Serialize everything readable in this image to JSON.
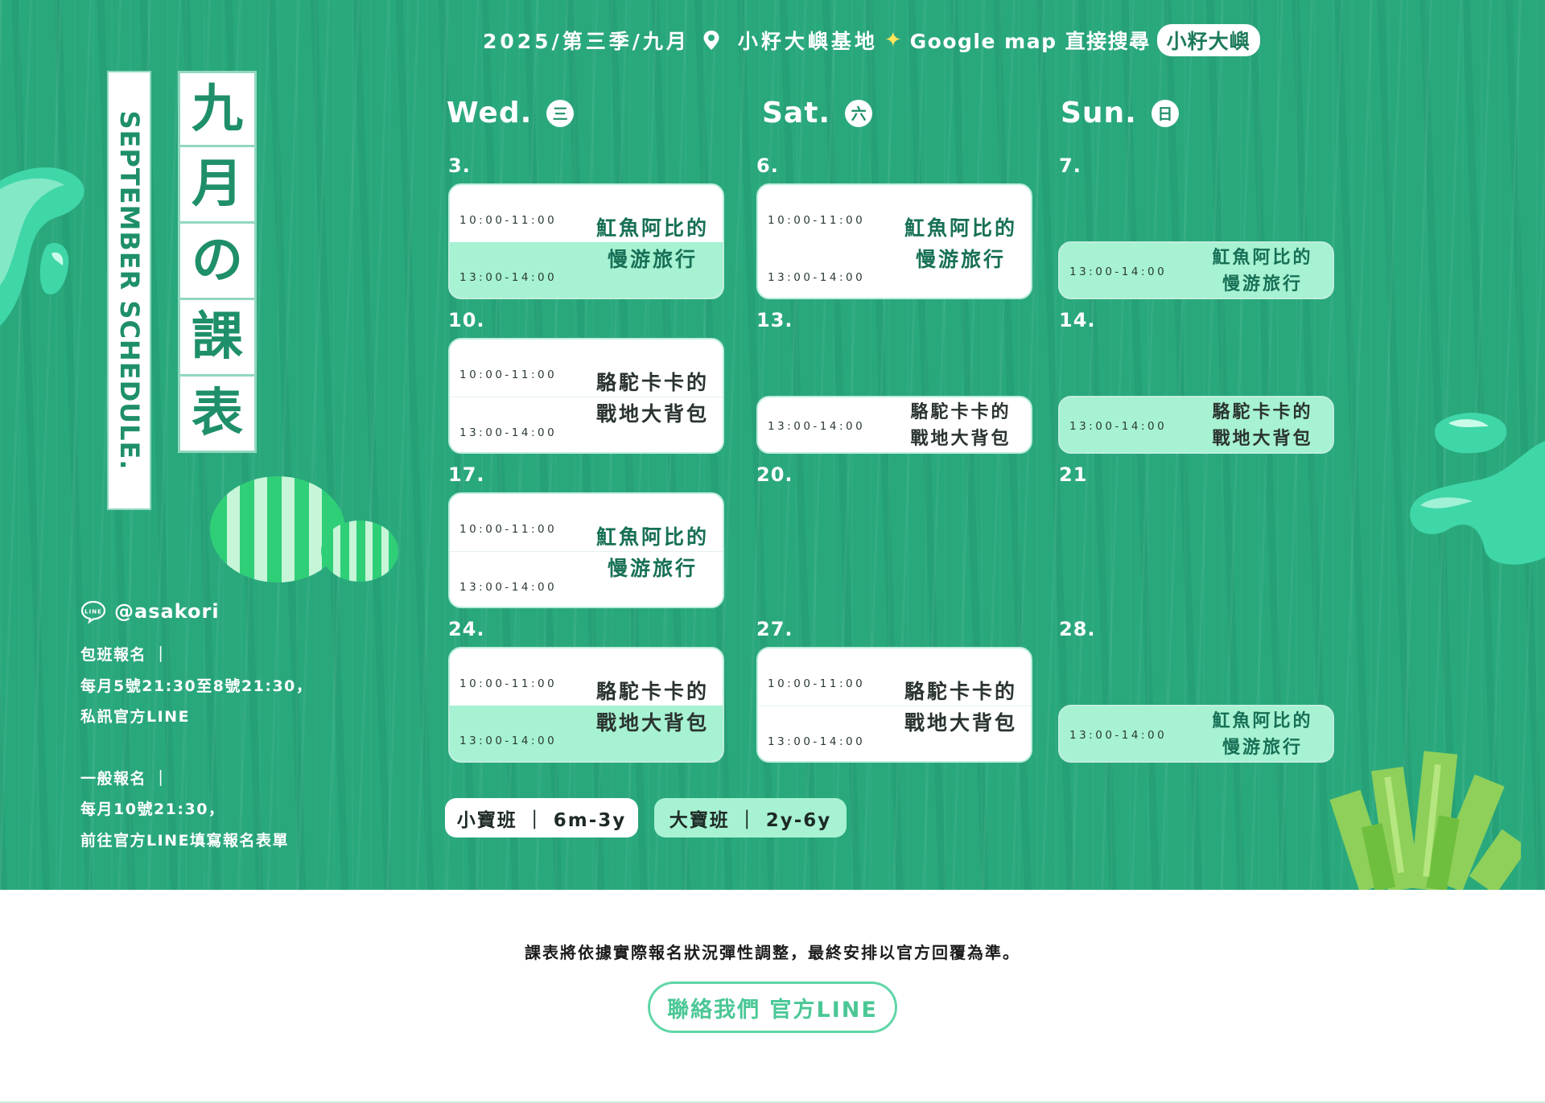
{
  "topbar": {
    "date_season": "2025/第三季/九月",
    "location": "小籽大嶼基地",
    "search_hint": "Google map 直接搜尋",
    "search_term": "小籽大嶼"
  },
  "title": {
    "english": "SEPTEMBER SCHEDULE.",
    "chinese_chars": [
      "九",
      "月",
      "の",
      "課",
      "表"
    ]
  },
  "info": {
    "line_id": "@asakori",
    "package_title": "包班報名 ｜",
    "package_line1": "每月5號21:30至8號21:30，",
    "package_line2": "私訊官方LINE",
    "general_title": "一般報名 ｜",
    "general_line1": "每月10號21:30，",
    "general_line2": "前往官方LINE填寫報名表單"
  },
  "days": {
    "wed": {
      "name": "Wed.",
      "badge": "三"
    },
    "sat": {
      "name": "Sat.",
      "badge": "六"
    },
    "sun": {
      "name": "Sun.",
      "badge": "日"
    }
  },
  "dates": {
    "d3": "3.",
    "d6": "6.",
    "d7": "7.",
    "d10": "10.",
    "d13": "13.",
    "d14": "14.",
    "d17": "17.",
    "d20": "20.",
    "d21": "21",
    "d24": "24.",
    "d27": "27.",
    "d28": "28."
  },
  "times": {
    "morning": "10:00-11:00",
    "afternoon": "13:00-14:00"
  },
  "courses": {
    "ray_line1": "魟魚阿比的",
    "ray_line2": "慢游旅行",
    "camel_line1": "駱駝卡卡的",
    "camel_line2": "戰地大背包"
  },
  "classes": {
    "small": "小寶班 ｜ 6m-3y",
    "big": "大寶班 ｜ 2y-6y"
  },
  "footer": {
    "note": "課表將依據實際報名狀況彈性調整，最終安排以官方回覆為準。",
    "contact_button": "聯絡我們 官方LINE"
  },
  "colors": {
    "background_green": "#29a87c",
    "mint": "#a6f2d2",
    "title_green": "#1e8f6a",
    "button_green": "#4bc796",
    "sparkle": "#ffe45c"
  }
}
